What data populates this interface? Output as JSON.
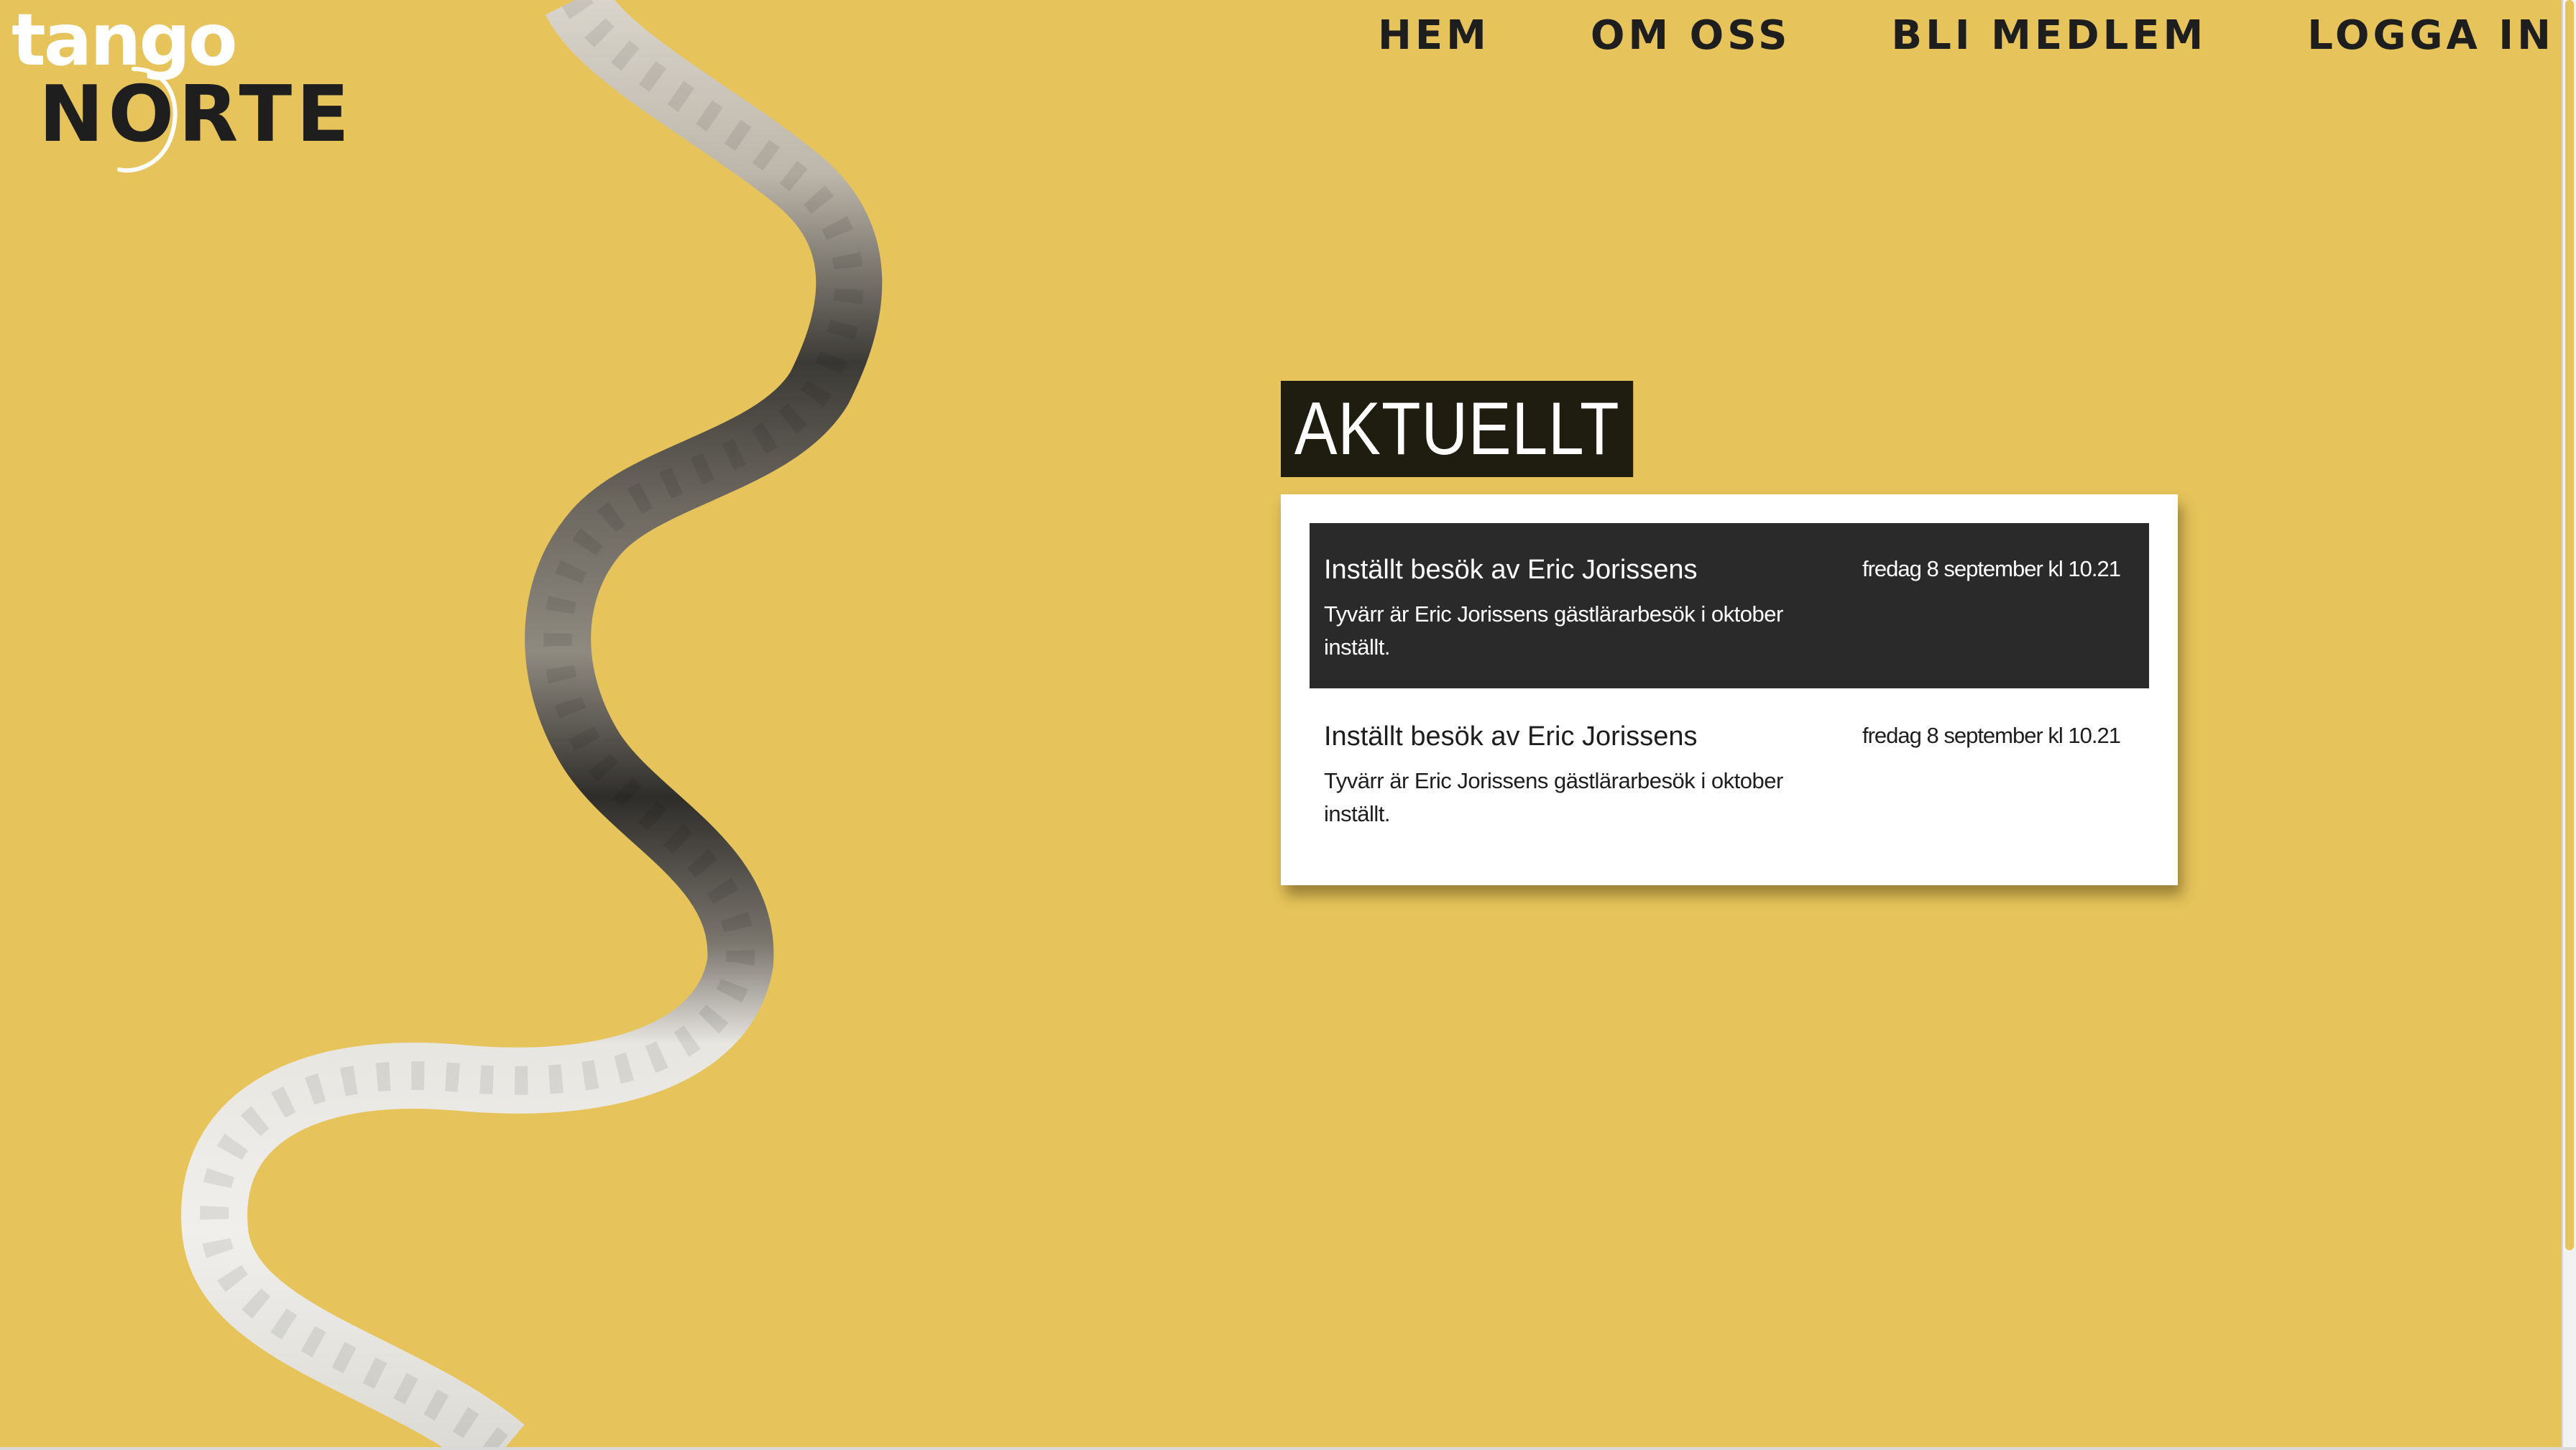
{
  "brand": {
    "logo_line1": "tango",
    "logo_line2": "NORTE"
  },
  "nav": {
    "items": [
      {
        "label": "HEM"
      },
      {
        "label": "OM OSS"
      },
      {
        "label": "BLI MEDLEM"
      },
      {
        "label": "LOGGA IN"
      }
    ]
  },
  "section": {
    "title": "AKTUELLT"
  },
  "news": [
    {
      "title": "Inställt besök av Eric Jorissens",
      "date": "fredag 8 september kl 10.21",
      "body": "Tyvärr är Eric Jorissens gästlärarbesök i oktober inställt.",
      "selected": true
    },
    {
      "title": "Inställt besök av Eric Jorissens",
      "date": "fredag 8 september kl 10.21",
      "body": "Tyvärr är Eric Jorissens gästlärarbesök i oktober inställt.",
      "selected": false
    }
  ],
  "colors": {
    "background": "#e6c45b",
    "dark": "#1e1e1e",
    "card": "#ffffff",
    "active_item": "#2a2a2a"
  }
}
